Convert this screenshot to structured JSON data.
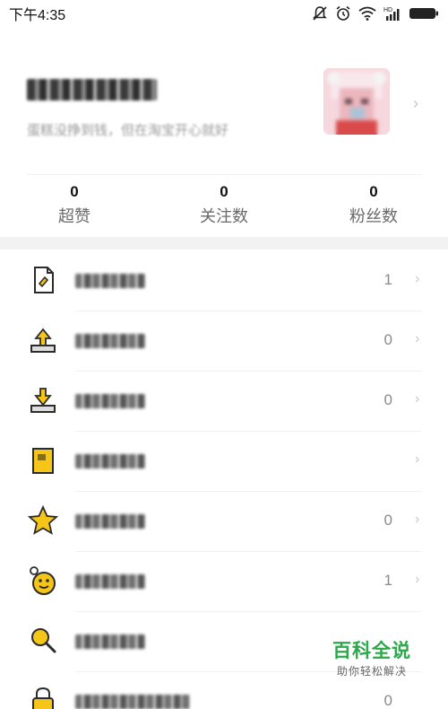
{
  "status_bar": {
    "time": "下午4:35",
    "icons": [
      "notification-muted-icon",
      "alarm-icon",
      "wifi-icon",
      "hd-signal-icon",
      "battery-icon"
    ],
    "hd_label": "HD"
  },
  "profile": {
    "bio": "蛋糕没挣到钱，但在淘宝开心就好",
    "avatar": "avatar-image"
  },
  "stats": [
    {
      "value": "0",
      "label": "超赞"
    },
    {
      "value": "0",
      "label": "关注数"
    },
    {
      "value": "0",
      "label": "粉丝数"
    }
  ],
  "menu": [
    {
      "icon": "document-icon",
      "count": "1"
    },
    {
      "icon": "upload-icon",
      "count": "0"
    },
    {
      "icon": "download-icon",
      "count": "0"
    },
    {
      "icon": "card-icon",
      "count": ""
    },
    {
      "icon": "star-icon",
      "count": "0"
    },
    {
      "icon": "smile-badge-icon",
      "count": "1"
    },
    {
      "icon": "search-icon",
      "count": ""
    },
    {
      "icon": "lock-icon",
      "count": "0"
    }
  ],
  "watermark": {
    "title": "百科全说",
    "subtitle": "助你轻松解决"
  },
  "colors": {
    "accent_yellow": "#F5C518",
    "watermark_green": "#2AA84A"
  }
}
